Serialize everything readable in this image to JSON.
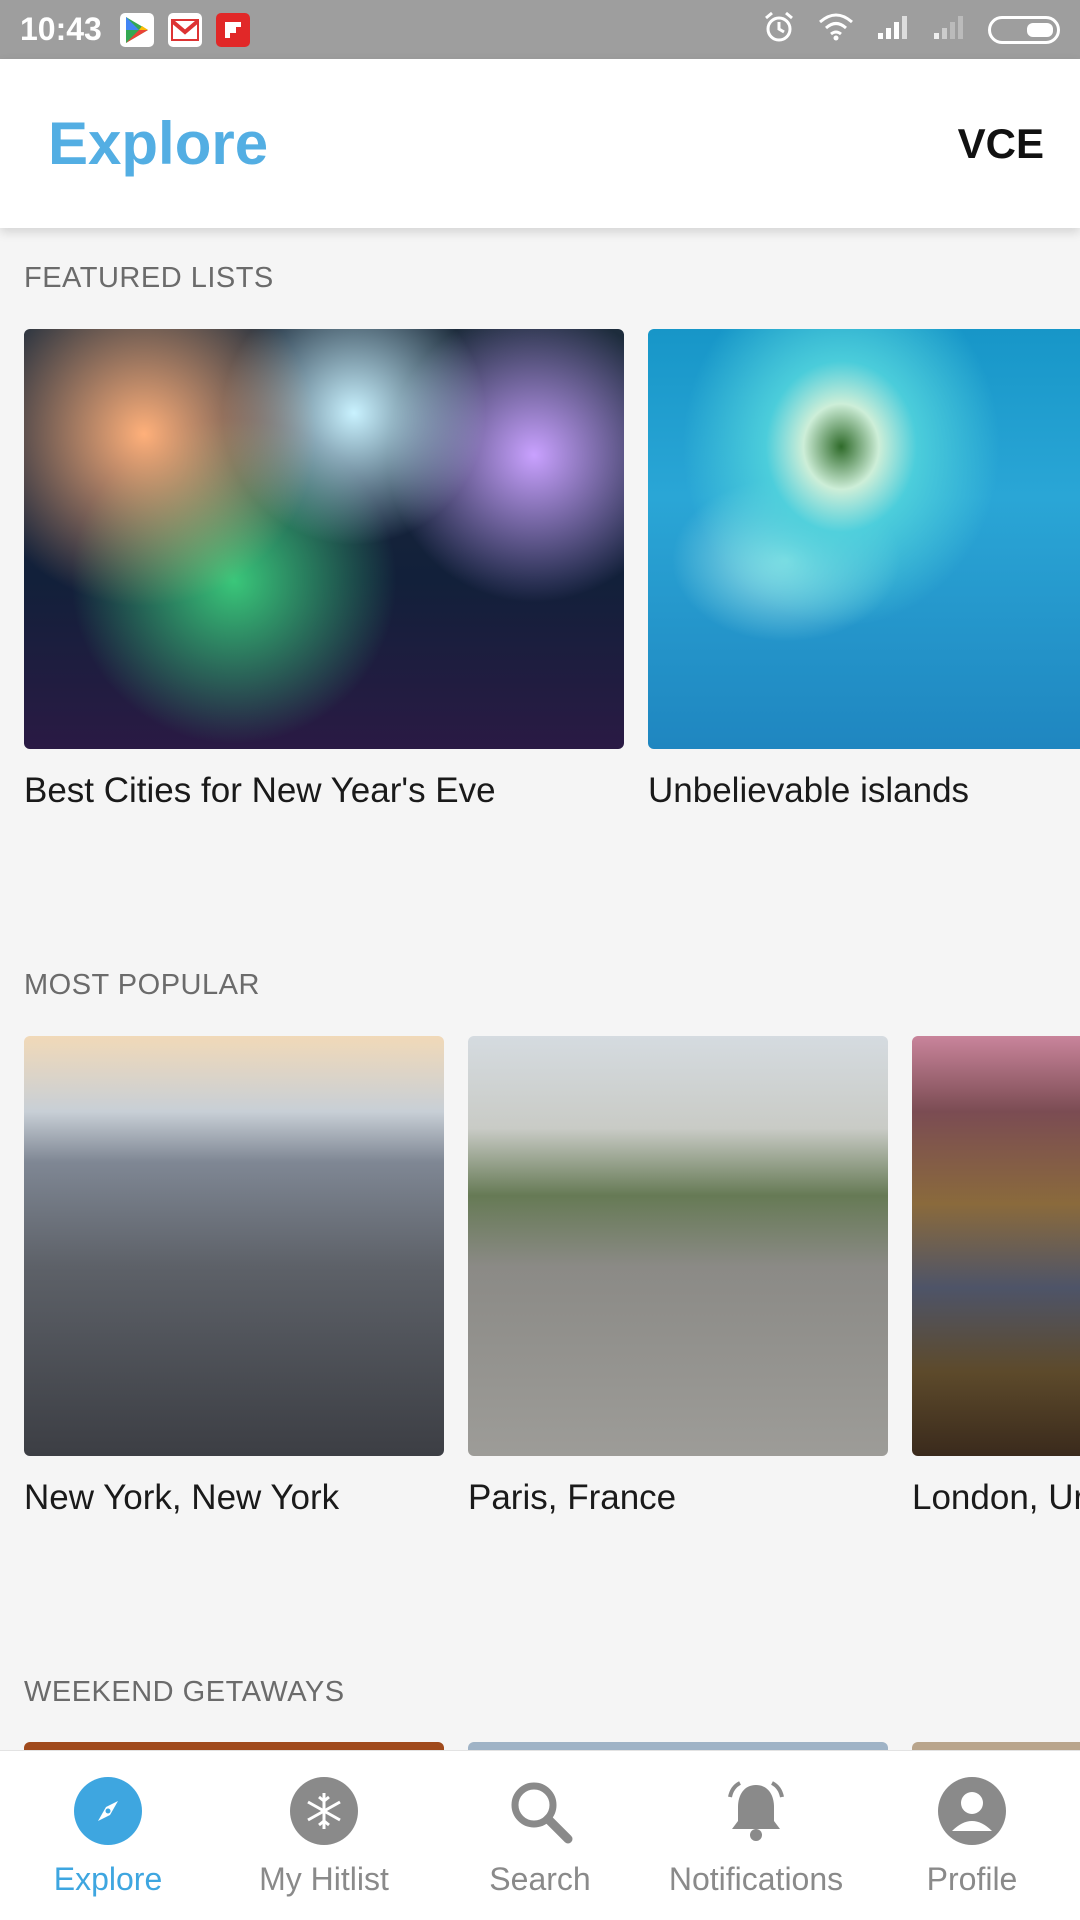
{
  "status_bar": {
    "time": "10:43",
    "apps": [
      "play-store-icon",
      "gmail-icon",
      "flipboard-icon"
    ],
    "right_icons": [
      "alarm-icon",
      "wifi-icon",
      "signal-icon",
      "signal-icon",
      "battery-icon"
    ]
  },
  "header": {
    "title": "Explore",
    "code": "VCE"
  },
  "sections": {
    "featured": {
      "label": "FEATURED LISTS",
      "cards": [
        {
          "title": "Best Cities for New Year's Eve"
        },
        {
          "title": "Unbelievable islands"
        }
      ]
    },
    "popular": {
      "label": "MOST POPULAR",
      "cards": [
        {
          "title": "New York, New York"
        },
        {
          "title": "Paris, France"
        },
        {
          "title": "London, Ur"
        }
      ]
    },
    "weekend": {
      "label": "WEEKEND GETAWAYS"
    }
  },
  "nav": {
    "items": [
      {
        "label": "Explore"
      },
      {
        "label": "My Hitlist"
      },
      {
        "label": "Search"
      },
      {
        "label": "Notifications"
      },
      {
        "label": "Profile"
      }
    ]
  },
  "colors": {
    "accent": "#53aee3",
    "status_bar": "#9e9e9e",
    "inactive": "#8a8a8a"
  }
}
